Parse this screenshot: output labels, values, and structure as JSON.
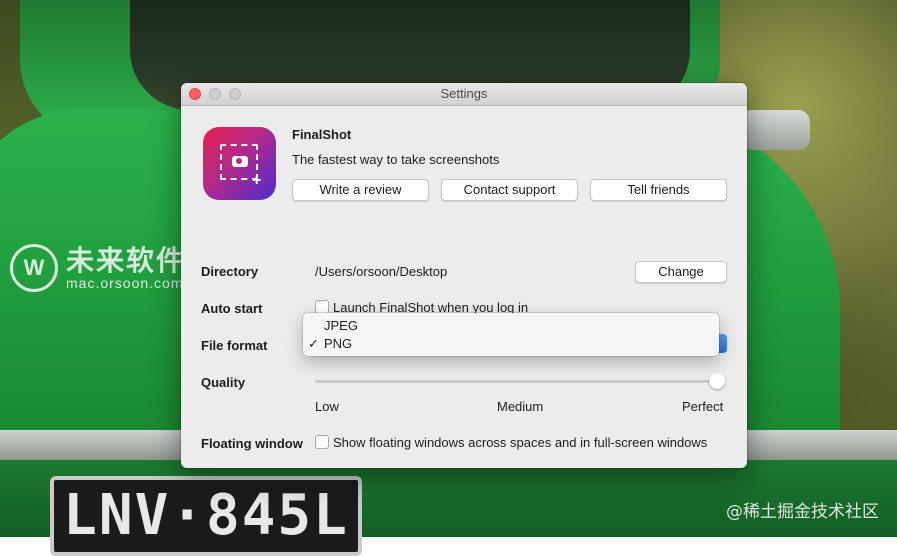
{
  "background": {
    "plate_text": "LNV·845L",
    "watermark_cn": "未来软件园",
    "watermark_url": "mac.orsoon.com",
    "watermark_right": "@稀土掘金技术社区"
  },
  "window": {
    "title": "Settings"
  },
  "app": {
    "name": "FinalShot",
    "tagline": "The fastest way to take screenshots"
  },
  "buttons": {
    "write_review": "Write a review",
    "contact_support": "Contact support",
    "tell_friends": "Tell friends",
    "change": "Change"
  },
  "settings": {
    "directory": {
      "label": "Directory",
      "value": "/Users/orsoon/Desktop"
    },
    "auto_start": {
      "label": "Auto start",
      "checkbox_text": "Launch FinalShot when you log in",
      "checked": false
    },
    "file_format": {
      "label": "File format",
      "selected": "PNG",
      "options": [
        "JPEG",
        "PNG"
      ]
    },
    "quality": {
      "label": "Quality",
      "ticks": [
        "Low",
        "Medium",
        "Perfect"
      ],
      "value": "Perfect",
      "level": 1.0
    },
    "floating_window": {
      "label": "Floating window",
      "checkbox_text": "Show floating windows across spaces and in full-screen windows",
      "checked": false
    }
  },
  "menu": {
    "items": [
      {
        "label": "JPEG",
        "check": ""
      },
      {
        "label": "PNG",
        "check": "✓"
      }
    ]
  },
  "colors": {
    "accent": "#2b6fe0",
    "close_light": "#fc615d",
    "icon_gradient_start": "#e61e4d",
    "icon_gradient_end": "#4b2ccf"
  }
}
